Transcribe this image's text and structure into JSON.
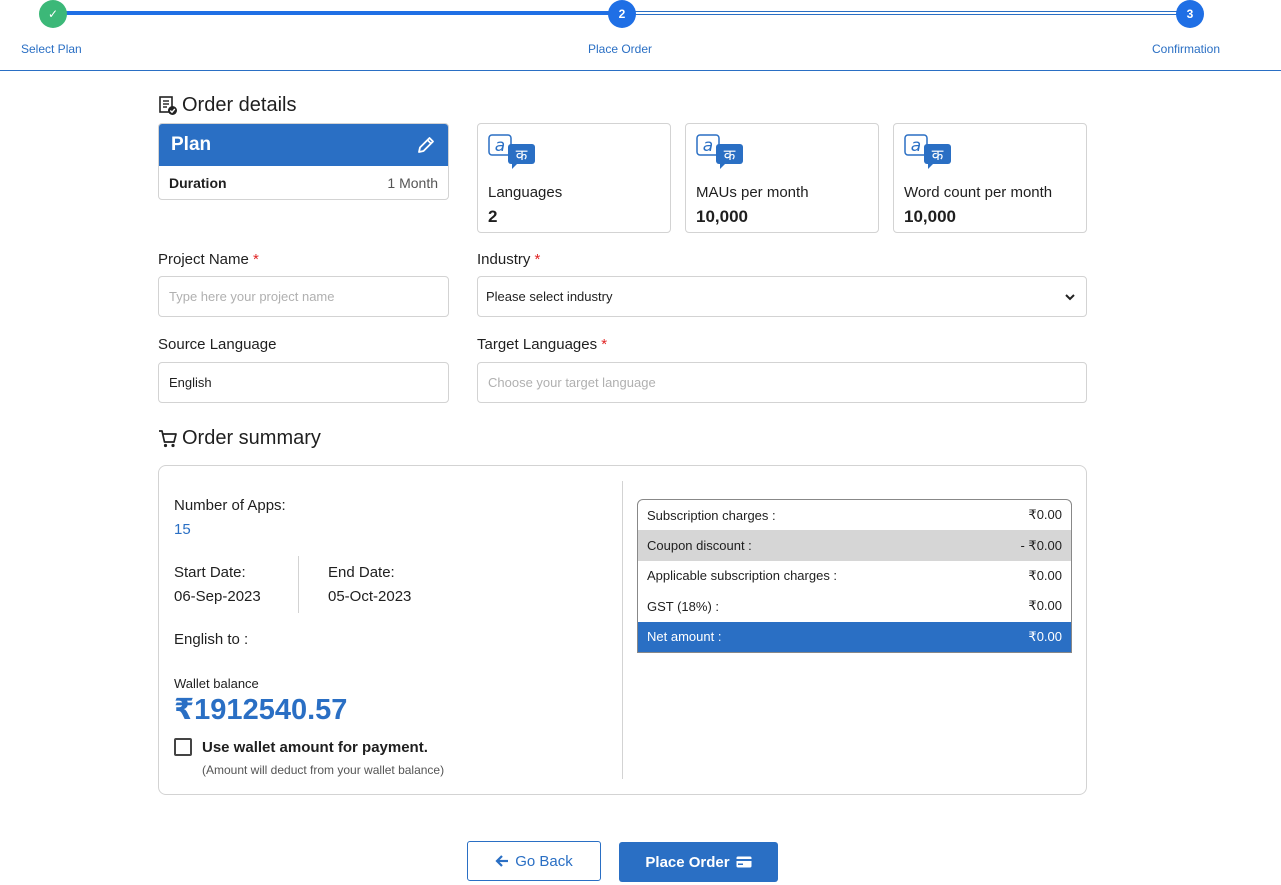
{
  "stepper": {
    "steps": [
      {
        "label": "Select Plan",
        "badge": "✓"
      },
      {
        "label": "Place Order",
        "badge": "2"
      },
      {
        "label": "Confirmation",
        "badge": "3"
      }
    ]
  },
  "order_details": {
    "title": "Order details",
    "plan": {
      "title": "Plan",
      "duration_label": "Duration",
      "duration_value": "1 Month"
    },
    "stats": [
      {
        "label": "Languages",
        "value": "2"
      },
      {
        "label": "MAUs per month",
        "value": "10,000"
      },
      {
        "label": "Word count per month",
        "value": "10,000"
      }
    ],
    "logo_glyph": "क"
  },
  "form": {
    "project_name": {
      "label": "Project Name",
      "placeholder": "Type here your project name"
    },
    "industry": {
      "label": "Industry",
      "value": "Please select industry"
    },
    "source_language": {
      "label": "Source Language",
      "value": "English"
    },
    "target_languages": {
      "label": "Target Languages",
      "placeholder": "Choose your target language"
    },
    "required_mark": "*"
  },
  "order_summary": {
    "title": "Order summary",
    "apps_label": "Number of Apps:",
    "apps_value": "15",
    "start_label": "Start Date:",
    "start_value": "06-Sep-2023",
    "end_label": "End Date:",
    "end_value": "05-Oct-2023",
    "english_to": "English to :",
    "wallet_label": "Wallet balance",
    "wallet_amount": "₹1912540.57",
    "use_wallet": "Use wallet amount for payment.",
    "use_wallet_note": "(Amount will deduct from your wallet balance)",
    "use_wallet_checked": false,
    "charges": [
      {
        "label": "Subscription charges :",
        "value": "₹0.00"
      },
      {
        "label": "Coupon discount :",
        "value": "- ₹0.00"
      },
      {
        "label": "Applicable subscription charges :",
        "value": "₹0.00"
      },
      {
        "label": "GST (18%) :",
        "value": "₹0.00"
      },
      {
        "label": "Net amount :",
        "value": "₹0.00"
      }
    ]
  },
  "actions": {
    "back_label": "Go Back",
    "order_label": "Place Order"
  },
  "colors": {
    "primary": "#2a6fc4",
    "step_active": "#1f6fe5",
    "step_done": "#3cb878",
    "required": "#e02424"
  }
}
